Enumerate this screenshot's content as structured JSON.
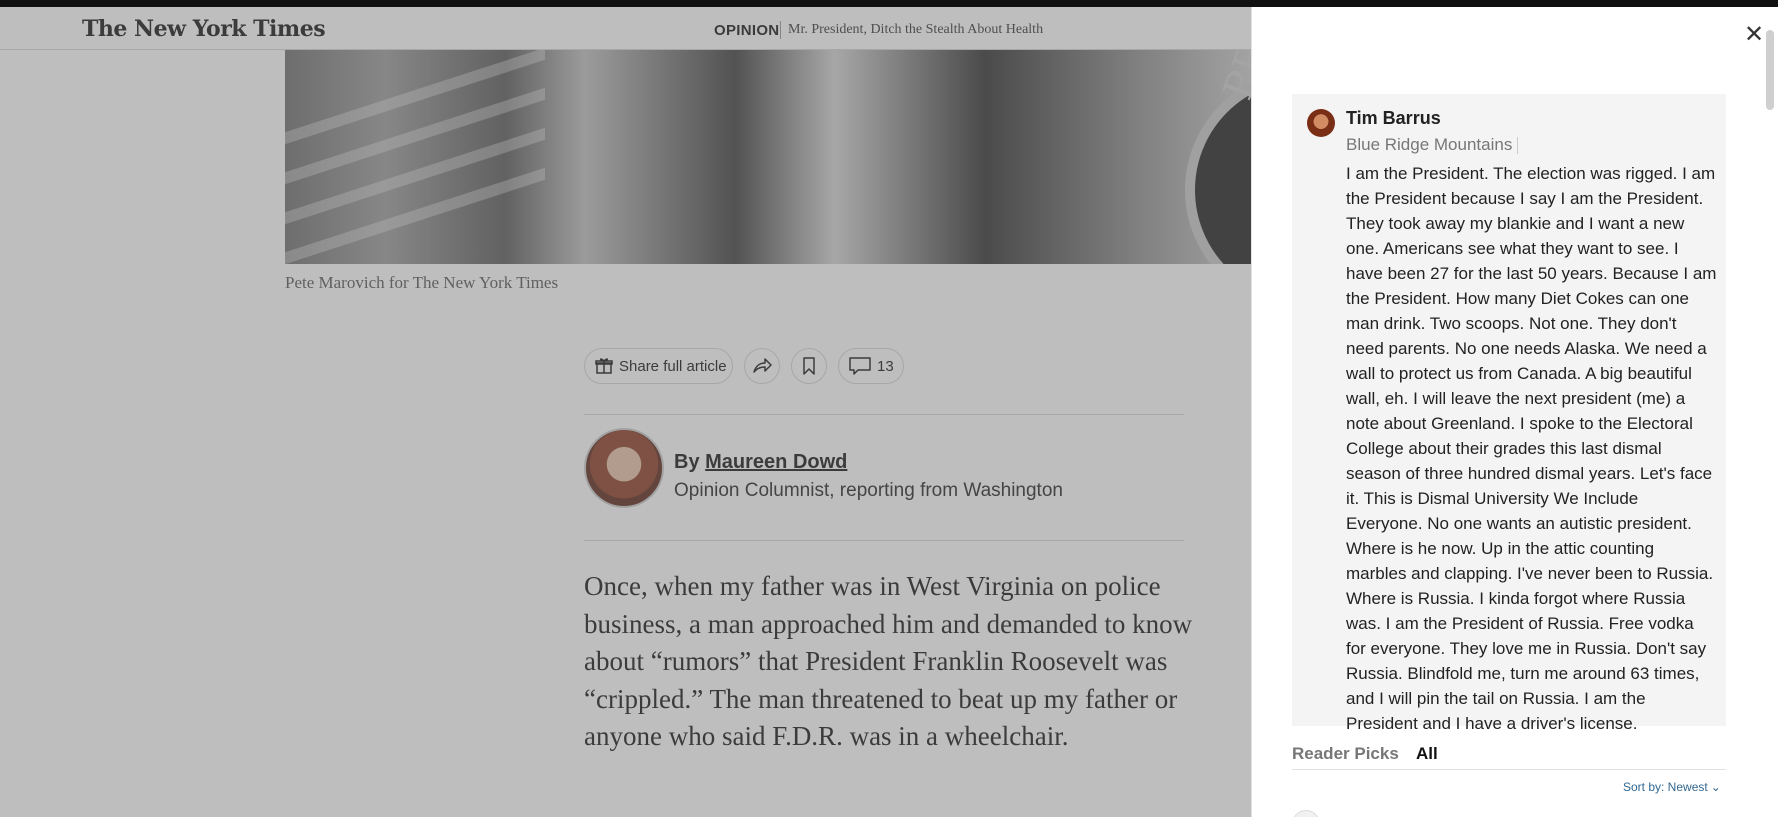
{
  "header": {
    "logo": "The New York Times",
    "section": "OPINION",
    "headline": "Mr. President, Ditch the Stealth About Health"
  },
  "article": {
    "photo_caption": "Pete Marovich for The New York Times",
    "photo_seal_text": "PRESID",
    "tools": {
      "share_full": "Share full article",
      "comment_count": "13"
    },
    "byline_prefix": "By",
    "author": "Maureen Dowd",
    "author_role": "Opinion Columnist, reporting from Washington",
    "body": "Once, when my father was in West Virginia on police business, a man approached him and demanded to know about “rumors” that President Franklin Roosevelt was “crippled.” The man threatened to beat up my father or anyone who said F.D.R. was in a wheelchair."
  },
  "comments": {
    "featured": {
      "name": "Tim Barrus",
      "location": "Blue Ridge Mountains",
      "text": "I am the President. The election was rigged. I am the President because I say I am the President. They took away my blankie and I want a new one. Americans see what they want to see. I have been 27 for the last 50 years. Because I am the President. How many Diet Cokes can one man drink. Two scoops. Not one. They don't need parents. No one needs Alaska. We need a wall to protect us from Canada. A big beautiful wall, eh. I will leave the next president (me) a note about Greenland. I spoke to the Electoral College about their grades this last dismal season of three hundred dismal years. Let's face it. This is Dismal University We Include Everyone. No one wants an autistic president. Where is he now. Up in the attic counting marbles and clapping. I've never been to Russia. Where is Russia. I kinda forgot where Russia was. I am the President of Russia. Free vodka for everyone. They love me in Russia. Don't say Russia. Blindfold me, turn me around 63 times, and I will pin the tail on Russia.   I am the President and I have a driver's license."
    },
    "tabs": [
      "Reader Picks",
      "All"
    ],
    "sort_label": "Sort by: Newest"
  }
}
